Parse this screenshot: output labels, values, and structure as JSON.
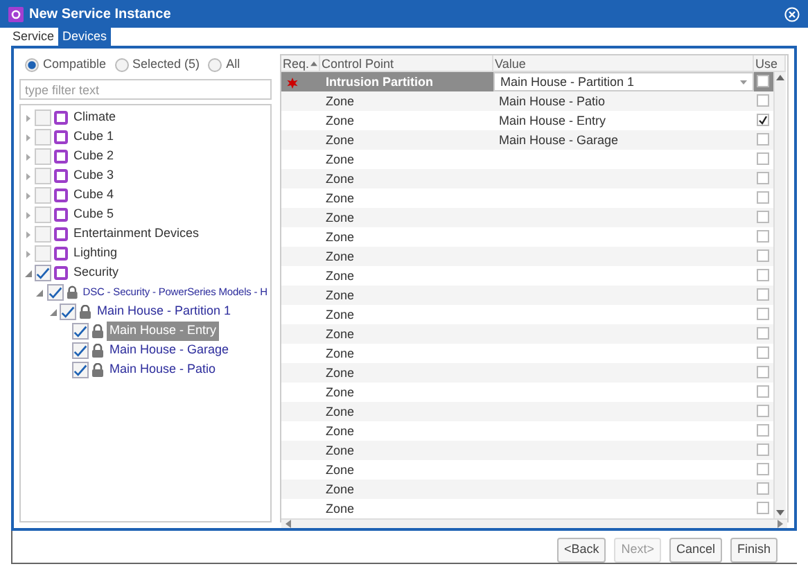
{
  "window": {
    "title": "New Service Instance"
  },
  "tabs": [
    {
      "label": "Service",
      "selected": false
    },
    {
      "label": "Devices",
      "selected": true
    }
  ],
  "filter": {
    "options": [
      {
        "label": "Compatible",
        "selected": true
      },
      {
        "label": "Selected (5)",
        "selected": false
      },
      {
        "label": "All",
        "selected": false
      }
    ],
    "placeholder": "type filter text"
  },
  "tree": [
    {
      "label": "Climate",
      "kind": "category",
      "checked": false,
      "expanded": false,
      "selected": false
    },
    {
      "label": "Cube 1",
      "kind": "category",
      "checked": false,
      "expanded": false,
      "selected": false
    },
    {
      "label": "Cube 2",
      "kind": "category",
      "checked": false,
      "expanded": false,
      "selected": false
    },
    {
      "label": "Cube 3",
      "kind": "category",
      "checked": false,
      "expanded": false,
      "selected": false
    },
    {
      "label": "Cube 4",
      "kind": "category",
      "checked": false,
      "expanded": false,
      "selected": false
    },
    {
      "label": "Cube 5",
      "kind": "category",
      "checked": false,
      "expanded": false,
      "selected": false
    },
    {
      "label": "Entertainment Devices",
      "kind": "category",
      "checked": false,
      "expanded": false,
      "selected": false
    },
    {
      "label": "Lighting",
      "kind": "category",
      "checked": false,
      "expanded": false,
      "selected": false
    },
    {
      "label": "Security",
      "kind": "category",
      "checked": true,
      "expanded": true,
      "selected": false,
      "children": [
        {
          "label": "DSC - Security - PowerSeries Models - H",
          "kind": "controller",
          "checked": true,
          "expanded": true,
          "selected": false,
          "children": [
            {
              "label": "Main House - Partition 1",
              "kind": "partition",
              "checked": true,
              "expanded": true,
              "selected": false,
              "children": [
                {
                  "label": "Main House - Entry",
                  "kind": "point",
                  "checked": true,
                  "selected": true
                },
                {
                  "label": "Main House - Garage",
                  "kind": "point",
                  "checked": true,
                  "selected": false
                },
                {
                  "label": "Main House - Patio",
                  "kind": "point",
                  "checked": true,
                  "selected": false
                }
              ]
            }
          ]
        }
      ]
    }
  ],
  "table": {
    "columns": [
      "Req.",
      "Control Point",
      "Value",
      "Use"
    ],
    "rows": [
      {
        "required": true,
        "control_point": "Intrusion Partition",
        "value": "Main House - Partition 1",
        "use": false,
        "selected": true
      },
      {
        "required": false,
        "control_point": "Zone",
        "value": "Main House - Patio",
        "use": false,
        "selected": false
      },
      {
        "required": false,
        "control_point": "Zone",
        "value": "Main House - Entry",
        "use": true,
        "selected": false
      },
      {
        "required": false,
        "control_point": "Zone",
        "value": "Main House - Garage",
        "use": false,
        "selected": false
      },
      {
        "required": false,
        "control_point": "Zone",
        "use": false,
        "selected": false
      },
      {
        "required": false,
        "control_point": "Zone",
        "use": false,
        "selected": false
      },
      {
        "required": false,
        "control_point": "Zone",
        "use": false,
        "selected": false
      },
      {
        "required": false,
        "control_point": "Zone",
        "use": false,
        "selected": false
      },
      {
        "required": false,
        "control_point": "Zone",
        "use": false,
        "selected": false
      },
      {
        "required": false,
        "control_point": "Zone",
        "use": false,
        "selected": false
      },
      {
        "required": false,
        "control_point": "Zone",
        "use": false,
        "selected": false
      },
      {
        "required": false,
        "control_point": "Zone",
        "use": false,
        "selected": false
      },
      {
        "required": false,
        "control_point": "Zone",
        "use": false,
        "selected": false
      },
      {
        "required": false,
        "control_point": "Zone",
        "use": false,
        "selected": false
      },
      {
        "required": false,
        "control_point": "Zone",
        "use": false,
        "selected": false
      },
      {
        "required": false,
        "control_point": "Zone",
        "use": false,
        "selected": false
      },
      {
        "required": false,
        "control_point": "Zone",
        "use": false,
        "selected": false
      },
      {
        "required": false,
        "control_point": "Zone",
        "use": false,
        "selected": false
      },
      {
        "required": false,
        "control_point": "Zone",
        "use": false,
        "selected": false
      },
      {
        "required": false,
        "control_point": "Zone",
        "use": false,
        "selected": false
      },
      {
        "required": false,
        "control_point": "Zone",
        "use": false,
        "selected": false
      },
      {
        "required": false,
        "control_point": "Zone",
        "use": false,
        "selected": false
      },
      {
        "required": false,
        "control_point": "Zone",
        "use": false,
        "selected": false
      }
    ]
  },
  "buttons": [
    {
      "label": "<Back",
      "disabled": false
    },
    {
      "label": "Next>",
      "disabled": true
    },
    {
      "label": "Cancel",
      "disabled": false
    },
    {
      "label": "Finish",
      "disabled": false
    }
  ]
}
